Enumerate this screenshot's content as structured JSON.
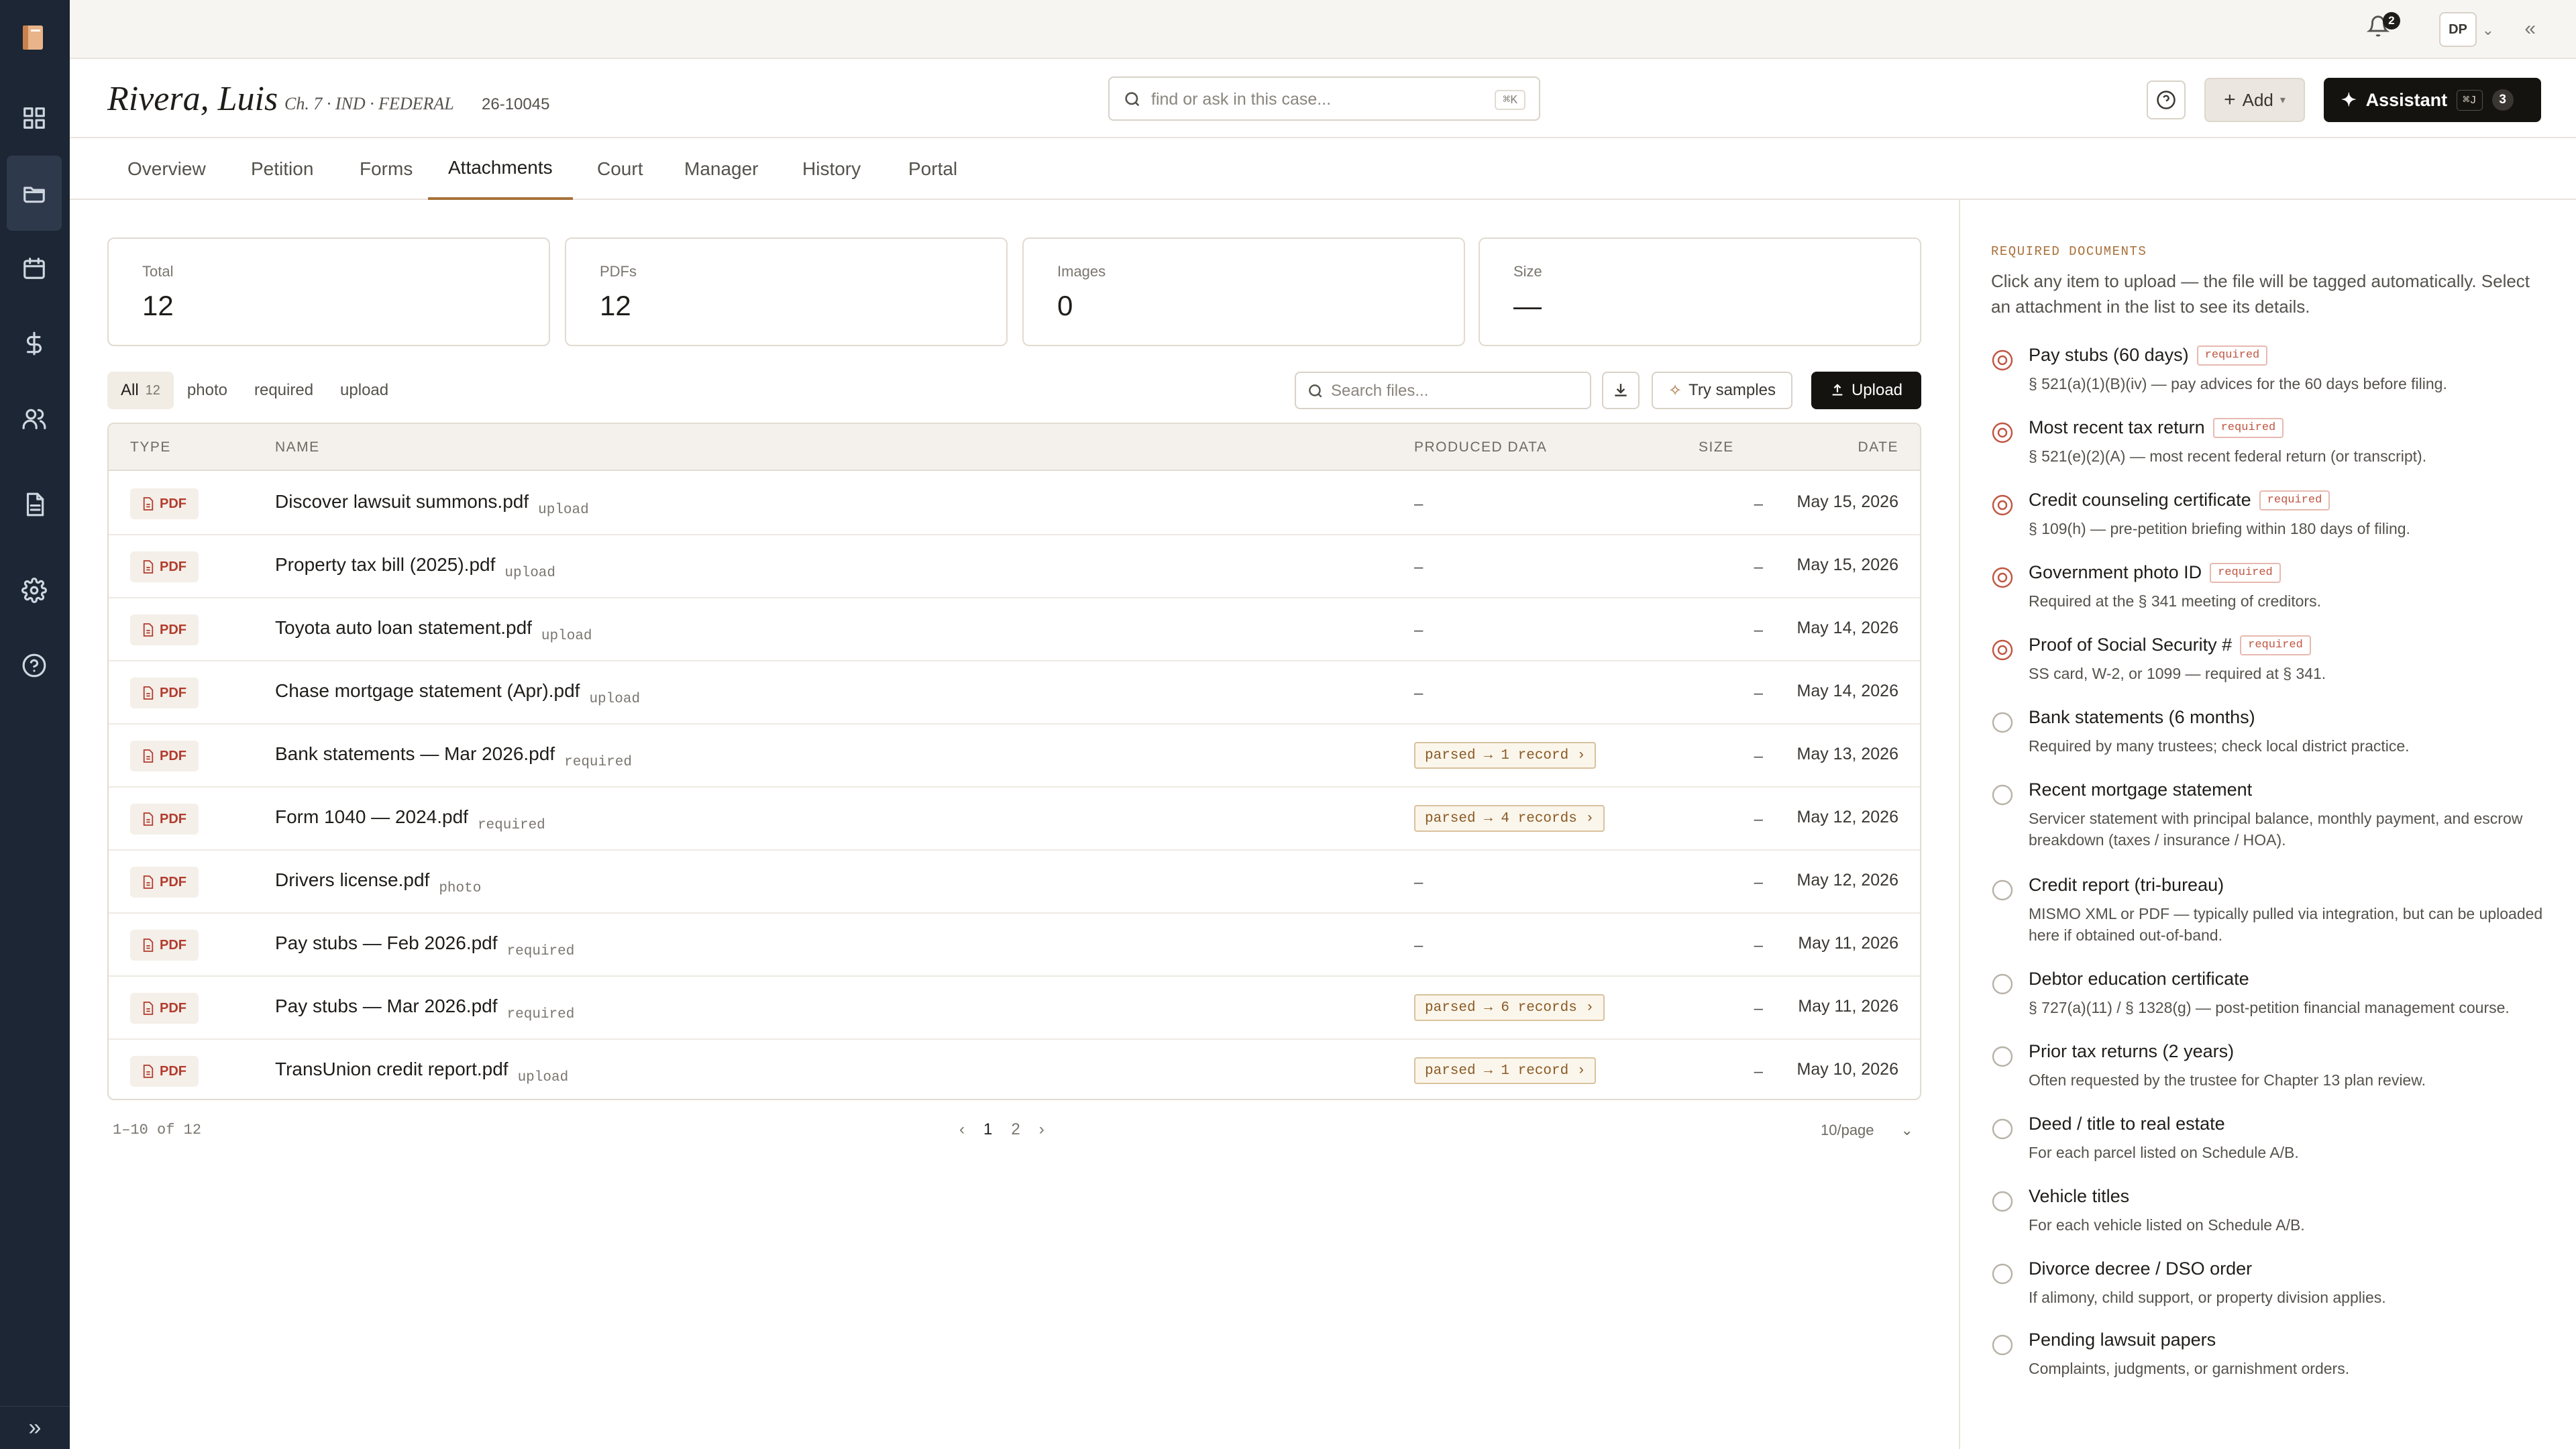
{
  "topbar": {
    "notifications": "2",
    "avatar": "DP"
  },
  "case": {
    "name": "Rivera, Luis",
    "meta": "Ch. 7 · IND · FEDERAL",
    "number": "26-10045",
    "search_placeholder": "find or ask in this case...",
    "search_shortcut": "⌘K",
    "add_label": "Add",
    "assistant_label": "Assistant",
    "assistant_shortcut": "⌘J",
    "assistant_count": "3"
  },
  "tabs": [
    "Overview",
    "Petition",
    "Forms",
    "Attachments",
    "Court",
    "Manager",
    "History",
    "Portal"
  ],
  "stats": [
    {
      "label": "Total",
      "value": "12"
    },
    {
      "label": "PDFs",
      "value": "12"
    },
    {
      "label": "Images",
      "value": "0"
    },
    {
      "label": "Size",
      "value": "—"
    }
  ],
  "filters": {
    "all": "All",
    "all_count": "12",
    "photo": "photo",
    "required": "required",
    "upload": "upload"
  },
  "toolbar": {
    "search_placeholder": "Search files...",
    "try_samples": "Try samples",
    "upload": "Upload"
  },
  "table": {
    "headers": {
      "type": "TYPE",
      "name": "NAME",
      "produced": "PRODUCED DATA",
      "size": "SIZE",
      "date": "DATE"
    },
    "type_label": "PDF",
    "rows": [
      {
        "name": "Discover lawsuit summons.pdf",
        "tag": "upload",
        "produced": "–",
        "size": "–",
        "date": "May 15, 2026"
      },
      {
        "name": "Property tax bill (2025).pdf",
        "tag": "upload",
        "produced": "–",
        "size": "–",
        "date": "May 15, 2026"
      },
      {
        "name": "Toyota auto loan statement.pdf",
        "tag": "upload",
        "produced": "–",
        "size": "–",
        "date": "May 14, 2026"
      },
      {
        "name": "Chase mortgage statement (Apr).pdf",
        "tag": "upload",
        "produced": "–",
        "size": "–",
        "date": "May 14, 2026"
      },
      {
        "name": "Bank statements — Mar 2026.pdf",
        "tag": "required",
        "produced": "parsed → 1 record ›",
        "size": "–",
        "date": "May 13, 2026"
      },
      {
        "name": "Form 1040 — 2024.pdf",
        "tag": "required",
        "produced": "parsed → 4 records ›",
        "size": "–",
        "date": "May 12, 2026"
      },
      {
        "name": "Drivers license.pdf",
        "tag": "photo",
        "produced": "–",
        "size": "–",
        "date": "May 12, 2026"
      },
      {
        "name": "Pay stubs — Feb 2026.pdf",
        "tag": "required",
        "produced": "–",
        "size": "–",
        "date": "May 11, 2026"
      },
      {
        "name": "Pay stubs — Mar 2026.pdf",
        "tag": "required",
        "produced": "parsed → 6 records ›",
        "size": "–",
        "date": "May 11, 2026"
      },
      {
        "name": "TransUnion credit report.pdf",
        "tag": "upload",
        "produced": "parsed → 1 record ›",
        "size": "–",
        "date": "May 10, 2026"
      }
    ]
  },
  "pager": {
    "range": "1–10 of 12",
    "pages": [
      "1",
      "2"
    ],
    "per_page": "10/page"
  },
  "side": {
    "title": "REQUIRED DOCUMENTS",
    "desc": "Click any item to upload — the file will be tagged automatically. Select an attachment in the list to see its details.",
    "required_tag": "required",
    "items": [
      {
        "title": "Pay stubs (60 days)",
        "required": true,
        "sub": "§ 521(a)(1)(B)(iv) — pay advices for the 60 days before filing."
      },
      {
        "title": "Most recent tax return",
        "required": true,
        "sub": "§ 521(e)(2)(A) — most recent federal return (or transcript)."
      },
      {
        "title": "Credit counseling certificate",
        "required": true,
        "sub": "§ 109(h) — pre-petition briefing within 180 days of filing."
      },
      {
        "title": "Government photo ID",
        "required": true,
        "sub": "Required at the § 341 meeting of creditors."
      },
      {
        "title": "Proof of Social Security #",
        "required": true,
        "sub": "SS card, W-2, or 1099 — required at § 341."
      },
      {
        "title": "Bank statements (6 months)",
        "required": false,
        "sub": "Required by many trustees; check local district practice."
      },
      {
        "title": "Recent mortgage statement",
        "required": false,
        "sub": "Servicer statement with principal balance, monthly payment, and escrow breakdown (taxes / insurance / HOA)."
      },
      {
        "title": "Credit report (tri-bureau)",
        "required": false,
        "sub": "MISMO XML or PDF — typically pulled via integration, but can be uploaded here if obtained out-of-band."
      },
      {
        "title": "Debtor education certificate",
        "required": false,
        "sub": "§ 727(a)(11) / § 1328(g) — post-petition financial management course."
      },
      {
        "title": "Prior tax returns (2 years)",
        "required": false,
        "sub": "Often requested by the trustee for Chapter 13 plan review."
      },
      {
        "title": "Deed / title to real estate",
        "required": false,
        "sub": "For each parcel listed on Schedule A/B."
      },
      {
        "title": "Vehicle titles",
        "required": false,
        "sub": "For each vehicle listed on Schedule A/B."
      },
      {
        "title": "Divorce decree / DSO order",
        "required": false,
        "sub": "If alimony, child support, or property division applies."
      },
      {
        "title": "Pending lawsuit papers",
        "required": false,
        "sub": "Complaints, judgments, or garnishment orders."
      }
    ]
  }
}
